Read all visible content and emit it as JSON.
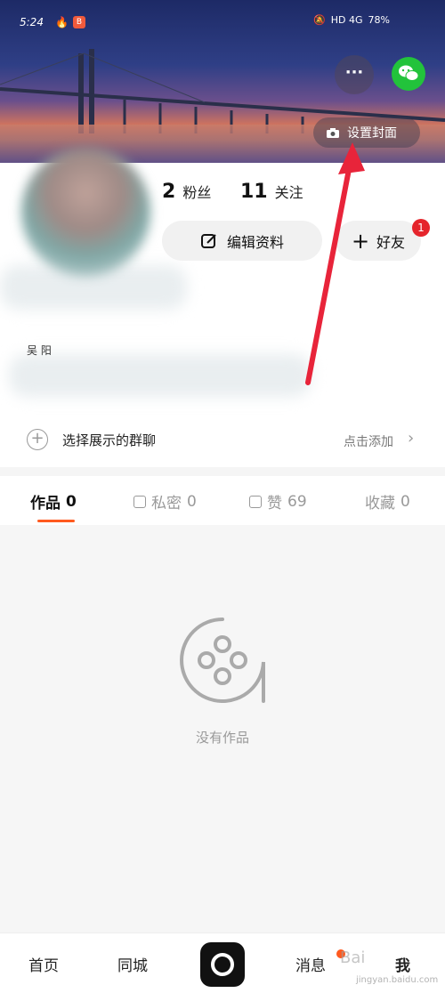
{
  "status_bar": {
    "time": "5:24",
    "app_badge": "B",
    "network_info": "HD 4G",
    "battery": "78%"
  },
  "header": {
    "more_label": "···",
    "set_cover_label": "设置封面"
  },
  "profile": {
    "fans_count": "2",
    "fans_label": "粉丝",
    "follow_count": "11",
    "follow_label": "关注",
    "edit_label": "编辑资料",
    "friend_label": "好友",
    "friend_badge": "1",
    "small_note": "吴 阳"
  },
  "group_chat": {
    "text": "选择展示的群聊",
    "action": "点击添加",
    "chevron": "›"
  },
  "tabs": [
    {
      "label": "作品",
      "count": "0"
    },
    {
      "label": "私密",
      "count": "0"
    },
    {
      "label": "赞",
      "count": "69"
    },
    {
      "label": "收藏",
      "count": "0"
    }
  ],
  "empty": {
    "text": "没有作品"
  },
  "bottom_nav": {
    "home": "首页",
    "local": "同城",
    "messages": "消息",
    "me": "我"
  },
  "watermark": {
    "brand": "Bai",
    "url": "jingyan.baidu.com"
  },
  "colors": {
    "accent": "#ff5a1f",
    "badge_red": "#e5252c",
    "wechat_green": "#22c33b",
    "arrow_red": "#e8243a"
  }
}
